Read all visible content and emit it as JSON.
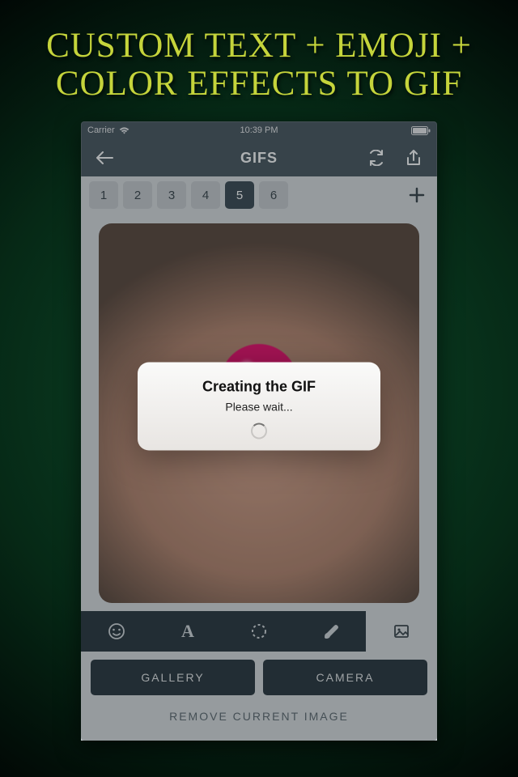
{
  "promo": {
    "headline": "CUSTOM TEXT + EMOJI + COLOR EFFECTS TO  GIF"
  },
  "status": {
    "carrier": "Carrier",
    "time": "10:39 PM",
    "battery_icon": "battery-full"
  },
  "nav": {
    "title": "GIFS"
  },
  "frames": {
    "items": [
      "1",
      "2",
      "3",
      "4",
      "5",
      "6"
    ],
    "active_index": 4
  },
  "dialog": {
    "title": "Creating the GIF",
    "subtitle": "Please wait..."
  },
  "actions": {
    "gallery": "GALLERY",
    "camera": "CAMERA",
    "remove": "REMOVE CURRENT IMAGE"
  }
}
